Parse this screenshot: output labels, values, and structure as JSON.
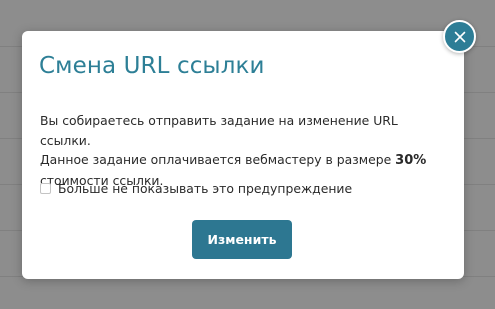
{
  "modal": {
    "title": "Смена URL ссылки",
    "message_line1": "Вы собираетесь отправить задание на изменение URL ссылки.",
    "message_line2_prefix": "Данное задание оплачивается вебмастеру в размере ",
    "message_line2_bold": "30%",
    "message_line3": "стоимости ссылки.",
    "checkbox_label": "Больше не показывать это предупреждение",
    "checkbox_checked": false,
    "submit_label": "Изменить",
    "close_icon": "close-icon"
  },
  "colors": {
    "accent": "#2d7f96",
    "button": "#2d7791",
    "overlay": "rgba(70,70,70,0.55)"
  }
}
